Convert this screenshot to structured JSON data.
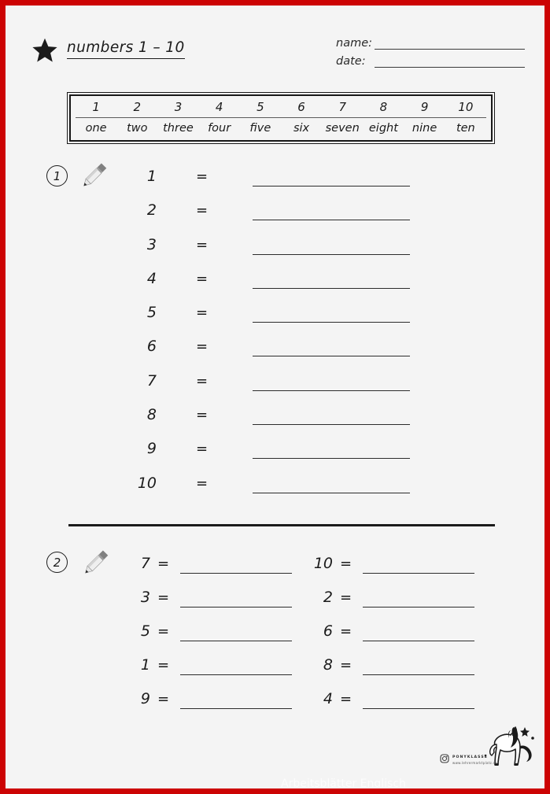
{
  "page": {
    "background_color": "#f4f4f4",
    "border_color": "#cc0303",
    "ink_color": "#1b1b1b"
  },
  "header": {
    "star_icon": "star-icon",
    "title": "numbers 1 – 10",
    "name_label": "name:",
    "date_label": "date:"
  },
  "reference_table": {
    "digits": [
      "1",
      "2",
      "3",
      "4",
      "5",
      "6",
      "7",
      "8",
      "9",
      "10"
    ],
    "words": [
      "one",
      "two",
      "three",
      "four",
      "five",
      "six",
      "seven",
      "eight",
      "nine",
      "ten"
    ]
  },
  "exercise1": {
    "marker": "1",
    "pencil_icon": "pencil-icon",
    "equals": "=",
    "prompts": [
      "1",
      "2",
      "3",
      "4",
      "5",
      "6",
      "7",
      "8",
      "9",
      "10"
    ]
  },
  "exercise2": {
    "marker": "2",
    "pencil_icon": "pencil-icon",
    "equals": "=",
    "rows": [
      {
        "left": "7",
        "right": "10"
      },
      {
        "left": "3",
        "right": "2"
      },
      {
        "left": "5",
        "right": "6"
      },
      {
        "left": "1",
        "right": "8"
      },
      {
        "left": "9",
        "right": "4"
      }
    ]
  },
  "footer": {
    "pony_icon": "pony-logo-icon",
    "instagram_icon": "instagram-icon",
    "brand_name": "PONYKLASSE",
    "brand_url": "www.lehrermarktplatz.de",
    "watermark": "Arbeitsblätter Englisch"
  }
}
